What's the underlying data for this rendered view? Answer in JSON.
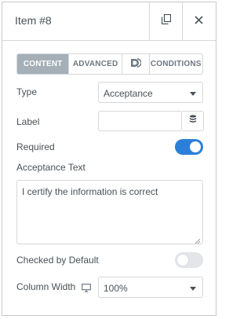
{
  "header": {
    "title": "Item #8",
    "duplicate_icon": "duplicate-icon",
    "close_icon": "close-icon"
  },
  "tabs": [
    {
      "label": "CONTENT",
      "active": true
    },
    {
      "label": "ADVANCED",
      "active": false
    },
    {
      "label": "",
      "icon": "dynamic-d-icon",
      "active": false
    },
    {
      "label": "CONDITIONS",
      "active": false
    }
  ],
  "fields": {
    "type": {
      "label": "Type",
      "value": "Acceptance"
    },
    "label": {
      "label": "Label",
      "value": "",
      "dynamic_icon": "database-icon"
    },
    "required": {
      "label": "Required",
      "on": true
    },
    "acceptance_text": {
      "label": "Acceptance Text",
      "value": "I certify the information is correct"
    },
    "checked_by_default": {
      "label": "Checked by Default",
      "on": false
    },
    "column_width": {
      "label": "Column Width",
      "device_icon": "desktop-icon",
      "value": "100%"
    }
  },
  "colors": {
    "accent": "#2b7fd8",
    "tab_active_bg": "#a4afb7",
    "border": "#d5d8dc",
    "text": "#495157"
  }
}
